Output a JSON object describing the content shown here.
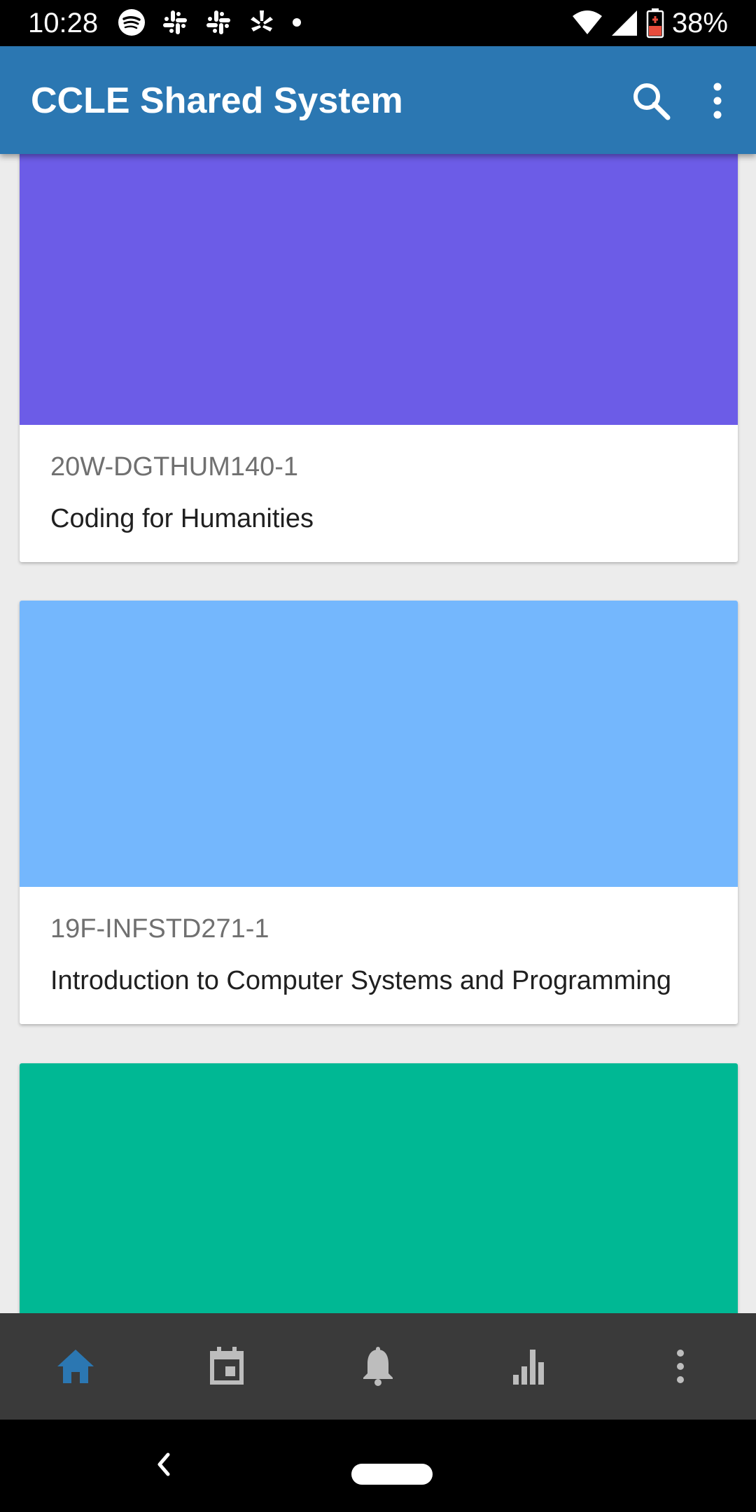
{
  "status_bar": {
    "time": "10:28",
    "battery": "38%",
    "icons": [
      "spotify-icon",
      "slack-icon",
      "slack-icon",
      "yelp-icon",
      "dot-icon",
      "wifi-icon",
      "signal-icon",
      "battery-icon"
    ]
  },
  "app_bar": {
    "title": "CCLE Shared System",
    "icons": [
      "search-icon",
      "more-vert-icon"
    ]
  },
  "courses": [
    {
      "code": "20W-DGTHUM140-1",
      "title": "Coding for Humanities",
      "color": "#6c5ce7"
    },
    {
      "code": "19F-INFSTD271-1",
      "title": "Introduction to Computer Systems and Programming",
      "color": "#74b7fd"
    },
    {
      "code": "",
      "title": "",
      "color": "#00b894"
    }
  ],
  "bottom_nav": {
    "items": [
      "home-icon",
      "calendar-icon",
      "bell-icon",
      "bar-chart-icon",
      "more-vert-icon"
    ],
    "active": "home-icon",
    "active_color": "#2b77b2",
    "inactive_color": "#bdbdbd"
  }
}
